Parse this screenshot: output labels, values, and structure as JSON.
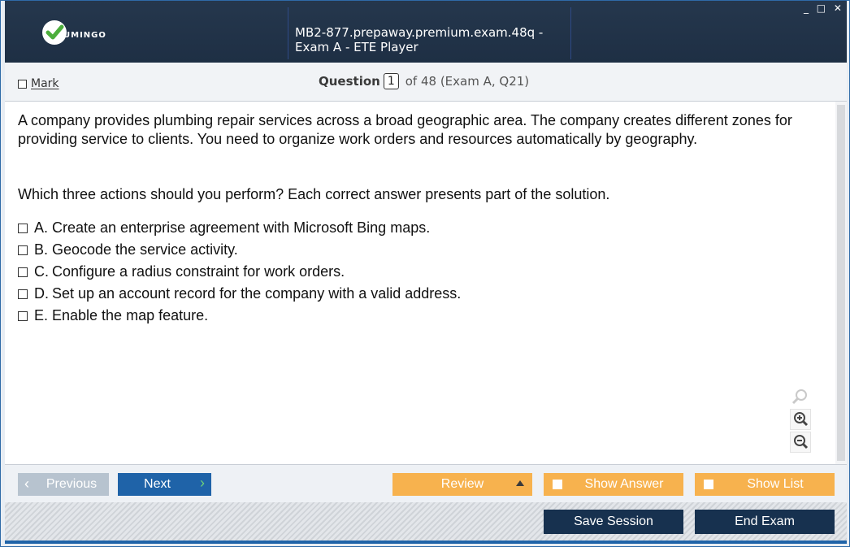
{
  "window": {
    "title": "MB2-877.prepaway.premium.exam.48q - Exam A - ETE Player",
    "logo_text": "UMINGO",
    "controls": "_ □ ✕"
  },
  "question_bar": {
    "mark_label": "Mark",
    "question_label": "Question",
    "question_number": "1",
    "question_rest": "of 48 (Exam A, Q21)"
  },
  "question": {
    "text": "A company provides plumbing repair services across a broad geographic area. The company creates different zones for providing service to clients. You need to organize work orders and resources automatically by geography.",
    "prompt": "Which three actions should you perform? Each correct answer presents part of the solution.",
    "options": [
      {
        "letter": "A.",
        "text": "Create an enterprise agreement with Microsoft Bing maps."
      },
      {
        "letter": "B.",
        "text": "Geocode the service activity."
      },
      {
        "letter": "C.",
        "text": "Configure a radius constraint for work orders."
      },
      {
        "letter": "D.",
        "text": "Set up an account record for the company with a valid address."
      },
      {
        "letter": "E.",
        "text": "Enable the map feature."
      }
    ]
  },
  "zoom": {
    "icons": [
      "magnifier-icon",
      "zoom-in-icon",
      "zoom-out-icon"
    ]
  },
  "nav": {
    "previous_label": "Previous",
    "next_label": "Next",
    "review_label": "Review",
    "show_answer_label": "Show Answer",
    "show_list_label": "Show List"
  },
  "footer": {
    "save_session_label": "Save Session",
    "end_exam_label": "End Exam"
  },
  "colors": {
    "titlebar": "#1e2f44",
    "accent_blue": "#1f63a8",
    "orange": "#f7b24e",
    "dark_button": "#17314f",
    "next_arrow": "#6cd07a",
    "logo_green": "#4cae3c"
  }
}
